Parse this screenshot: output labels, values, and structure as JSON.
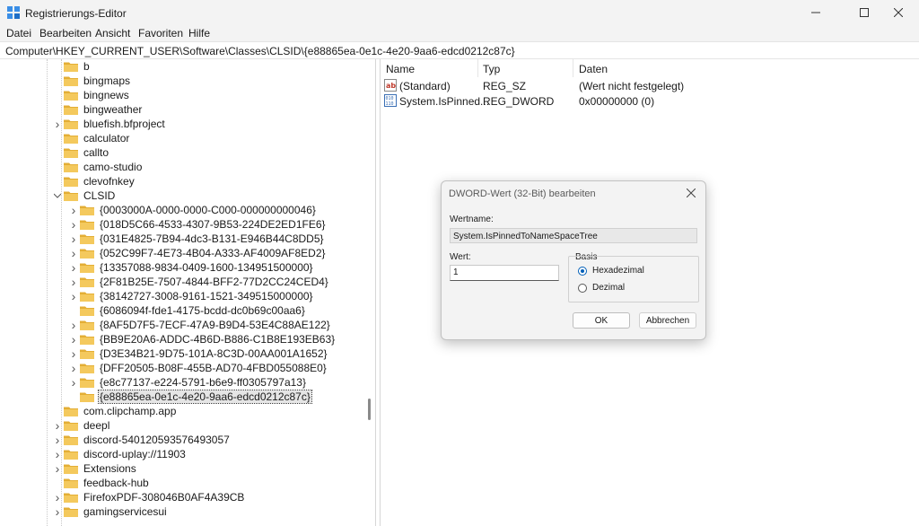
{
  "window": {
    "title": "Registrierungs-Editor",
    "controls": [
      "minimize-icon",
      "maximize-icon",
      "close-icon"
    ]
  },
  "menu": [
    "Datei",
    "Bearbeiten",
    "Ansicht",
    "Favoriten",
    "Hilfe"
  ],
  "address": "Computer\\HKEY_CURRENT_USER\\Software\\Classes\\CLSID\\{e88865ea-0e1c-4e20-9aa6-edcd0212c87c}",
  "tree": {
    "items": [
      {
        "label": "b",
        "level": 1,
        "expander": "none"
      },
      {
        "label": "bingmaps",
        "level": 1,
        "expander": "none"
      },
      {
        "label": "bingnews",
        "level": 1,
        "expander": "none"
      },
      {
        "label": "bingweather",
        "level": 1,
        "expander": "none"
      },
      {
        "label": "bluefish.bfproject",
        "level": 1,
        "expander": "collapsed"
      },
      {
        "label": "calculator",
        "level": 1,
        "expander": "none"
      },
      {
        "label": "callto",
        "level": 1,
        "expander": "none"
      },
      {
        "label": "camo-studio",
        "level": 1,
        "expander": "none"
      },
      {
        "label": "clevofnkey",
        "level": 1,
        "expander": "none"
      },
      {
        "label": "CLSID",
        "level": 1,
        "expander": "expanded"
      },
      {
        "label": "{0003000A-0000-0000-C000-000000000046}",
        "level": 2,
        "expander": "collapsed"
      },
      {
        "label": "{018D5C66-4533-4307-9B53-224DE2ED1FE6}",
        "level": 2,
        "expander": "collapsed"
      },
      {
        "label": "{031E4825-7B94-4dc3-B131-E946B44C8DD5}",
        "level": 2,
        "expander": "collapsed"
      },
      {
        "label": "{052C99F7-4E73-4B04-A333-AF4009AF8ED2}",
        "level": 2,
        "expander": "collapsed"
      },
      {
        "label": "{13357088-9834-0409-1600-134951500000}",
        "level": 2,
        "expander": "collapsed"
      },
      {
        "label": "{2F81B25E-7507-4844-BFF2-77D2CC24CED4}",
        "level": 2,
        "expander": "collapsed"
      },
      {
        "label": "{38142727-3008-9161-1521-349515000000}",
        "level": 2,
        "expander": "collapsed"
      },
      {
        "label": "{6086094f-fde1-4175-bcdd-dc0b69c00aa6}",
        "level": 2,
        "expander": "none"
      },
      {
        "label": "{8AF5D7F5-7ECF-47A9-B9D4-53E4C88AE122}",
        "level": 2,
        "expander": "collapsed"
      },
      {
        "label": "{BB9E20A6-ADDC-4B6D-B886-C1B8E193EB63}",
        "level": 2,
        "expander": "collapsed"
      },
      {
        "label": "{D3E34B21-9D75-101A-8C3D-00AA001A1652}",
        "level": 2,
        "expander": "collapsed"
      },
      {
        "label": "{DFF20505-B08F-455B-AD70-4FBD055088E0}",
        "level": 2,
        "expander": "collapsed"
      },
      {
        "label": "{e8c77137-e224-5791-b6e9-ff0305797a13}",
        "level": 2,
        "expander": "collapsed"
      },
      {
        "label": "{e88865ea-0e1c-4e20-9aa6-edcd0212c87c}",
        "level": 2,
        "expander": "none",
        "selected": true
      },
      {
        "label": "com.clipchamp.app",
        "level": 1,
        "expander": "none"
      },
      {
        "label": "deepl",
        "level": 1,
        "expander": "collapsed"
      },
      {
        "label": "discord-540120593576493057",
        "level": 1,
        "expander": "collapsed"
      },
      {
        "label": "discord-uplay://11903",
        "level": 1,
        "expander": "collapsed"
      },
      {
        "label": "Extensions",
        "level": 1,
        "expander": "collapsed"
      },
      {
        "label": "feedback-hub",
        "level": 1,
        "expander": "none"
      },
      {
        "label": "FirefoxPDF-308046B0AF4A39CB",
        "level": 1,
        "expander": "collapsed"
      },
      {
        "label": "gamingservicesui",
        "level": 1,
        "expander": "collapsed"
      }
    ]
  },
  "values_pane": {
    "columns": [
      "Name",
      "Typ",
      "Daten"
    ],
    "rows": [
      {
        "name": "(Standard)",
        "type": "REG_SZ",
        "data": "(Wert nicht festgelegt)",
        "icon": "string-value-icon"
      },
      {
        "name": "System.IsPinned...",
        "type": "REG_DWORD",
        "data": "0x00000000 (0)",
        "icon": "binary-value-icon"
      }
    ]
  },
  "dialog": {
    "title": "DWORD-Wert (32-Bit) bearbeiten",
    "name_label": "Wertname:",
    "name_value": "System.IsPinnedToNameSpaceTree",
    "value_label": "Wert:",
    "value": "1",
    "basis_label": "Basis",
    "hex_label": "Hexadezimal",
    "dec_label": "Dezimal",
    "ok_label": "OK",
    "cancel_label": "Abbrechen",
    "selected_basis": "Hexadezimal"
  },
  "colors": {
    "folder": "#f4c95d",
    "folder_dark": "#e3ae35",
    "accent": "#005fb8"
  }
}
